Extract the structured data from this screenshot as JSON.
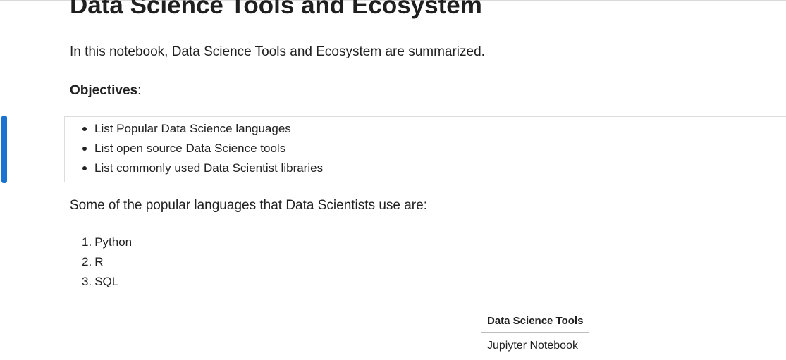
{
  "notebook": {
    "title": "Data Science Tools and Ecosystem",
    "intro": "In this notebook, Data Science Tools and Ecosystem are summarized.",
    "objectives_label": "Objectives",
    "objectives_suffix": ":",
    "objectives": [
      "List Popular Data Science languages",
      "List open source Data Science tools",
      "List commonly used Data Scientist libraries"
    ],
    "languages_intro": "Some of the popular languages that Data Scientists use are:",
    "languages": [
      {
        "num": "1.",
        "name": "Python"
      },
      {
        "num": "2.",
        "name": "R"
      },
      {
        "num": "3.",
        "name": "SQL"
      }
    ],
    "tools_table": {
      "header": "Data Science Tools",
      "rows": [
        "Jupiyter Notebook"
      ]
    }
  },
  "colors": {
    "active_cell_indicator": "#1a73d1",
    "cell_border": "#dcdcdc"
  }
}
